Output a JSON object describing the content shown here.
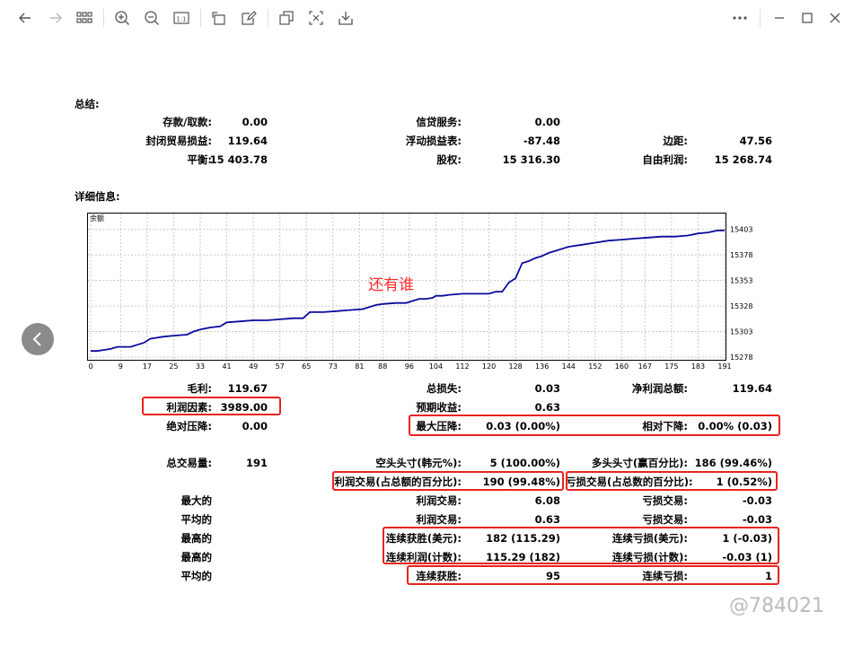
{
  "toolbar": {
    "icons": [
      "back-arrow-icon",
      "forward-arrow-icon",
      "grid-icon",
      "zoom-in-icon",
      "zoom-out-icon",
      "actual-size-icon",
      "rotate-icon",
      "edit-icon",
      "copy-icon",
      "crop-icon",
      "download-icon",
      "more-icon",
      "minimize-icon",
      "maximize-icon",
      "close-icon"
    ]
  },
  "summary": {
    "title": "总结:",
    "deposit_label": "存款/取款:",
    "deposit_value": "0.00",
    "credit_label": "信贷服务:",
    "credit_value": "0.00",
    "closed_pl_label": "封闭贸易损益:",
    "closed_pl_value": "119.64",
    "floating_label": "浮动损益表:",
    "floating_value": "-87.48",
    "margin_label": "边距:",
    "margin_value": "47.56",
    "balance_label": "平衡:",
    "balance_value": "15 403.78",
    "equity_label": "股权:",
    "equity_value": "15 316.30",
    "free_margin_label": "自由利润:",
    "free_margin_value": "15 268.74"
  },
  "details": {
    "title": "详细信息:",
    "gross_profit_label": "毛利:",
    "gross_profit_value": "119.67",
    "gross_loss_label": "总损失:",
    "gross_loss_value": "0.03",
    "net_profit_label": "净利润总额:",
    "net_profit_value": "119.64",
    "profit_factor_label": "利润因素:",
    "profit_factor_value": "3989.00",
    "expected_payoff_label": "预期收益:",
    "expected_payoff_value": "0.63",
    "abs_drawdown_label": "绝对压降:",
    "abs_drawdown_value": "0.00",
    "max_drawdown_label": "最大压降:",
    "max_drawdown_value": "0.03 (0.00%)",
    "rel_drawdown_label": "相对下降:",
    "rel_drawdown_value": "0.00% (0.03)",
    "total_trades_label": "总交易量:",
    "total_trades_value": "191",
    "short_label": "空头头寸(韩元%):",
    "short_value": "5 (100.00%)",
    "long_label": "多头头寸(赢百分比):",
    "long_value": "186 (99.46%)",
    "profit_trades_label": "利润交易(占总额的百分比):",
    "profit_trades_value": "190 (99.48%)",
    "loss_trades_label": "亏损交易(占总数的百分比):",
    "loss_trades_value": "1 (0.52%)",
    "largest_label": "最大的",
    "largest_profit_label": "利润交易:",
    "largest_profit_value": "6.08",
    "largest_loss_label": "亏损交易:",
    "largest_loss_value": "-0.03",
    "average_label": "平均的",
    "avg_profit_label": "利润交易:",
    "avg_profit_value": "0.63",
    "avg_loss_label": "亏损交易:",
    "avg_loss_value": "-0.03",
    "max_label_1": "最高的",
    "cons_wins_usd_label": "连续获胜(美元):",
    "cons_wins_usd_value": "182 (115.29)",
    "cons_loss_usd_label": "连续亏损(美元):",
    "cons_loss_usd_value": "1 (-0.03)",
    "max_label_2": "最高的",
    "cons_profit_count_label": "连续利润(计数):",
    "cons_profit_count_value": "115.29 (182)",
    "cons_loss_count_label": "连续亏损(计数):",
    "cons_loss_count_value": "-0.03 (1)",
    "average_label_2": "平均的",
    "avg_cons_wins_label": "连续获胜:",
    "avg_cons_wins_value": "95",
    "avg_cons_losses_label": "连续亏损:",
    "avg_cons_losses_value": "1"
  },
  "overlay_text": "还有谁",
  "watermark": "@784021",
  "colors": {
    "line": "#0a0a9e",
    "highlight": "#e8231f"
  },
  "chart_data": {
    "type": "line",
    "title": "余额",
    "x_ticks": [
      "0",
      "9",
      "17",
      "25",
      "33",
      "41",
      "49",
      "57",
      "65",
      "73",
      "81",
      "88",
      "96",
      "104",
      "112",
      "120",
      "128",
      "136",
      "144",
      "152",
      "160",
      "167",
      "175",
      "183",
      "191"
    ],
    "y_ticks": [
      "15403",
      "15378",
      "15353",
      "15328",
      "15303",
      "15278"
    ],
    "ylim": [
      15278,
      15408
    ],
    "xlim": [
      0,
      191
    ],
    "grid": true,
    "series": [
      {
        "values": [
          [
            0,
            15284
          ],
          [
            2,
            15284
          ],
          [
            4,
            15285
          ],
          [
            6,
            15286
          ],
          [
            8,
            15288
          ],
          [
            10,
            15288
          ],
          [
            12,
            15288
          ],
          [
            14,
            15290
          ],
          [
            16,
            15292
          ],
          [
            18,
            15296
          ],
          [
            20,
            15297
          ],
          [
            22,
            15298
          ],
          [
            25,
            15299
          ],
          [
            29,
            15300
          ],
          [
            31,
            15303
          ],
          [
            33,
            15305
          ],
          [
            36,
            15307
          ],
          [
            39,
            15308
          ],
          [
            41,
            15312
          ],
          [
            45,
            15313
          ],
          [
            49,
            15314
          ],
          [
            53,
            15314
          ],
          [
            57,
            15315
          ],
          [
            61,
            15316
          ],
          [
            64,
            15316
          ],
          [
            66,
            15322
          ],
          [
            70,
            15322
          ],
          [
            74,
            15323
          ],
          [
            78,
            15324
          ],
          [
            82,
            15325
          ],
          [
            86,
            15329
          ],
          [
            88,
            15330
          ],
          [
            92,
            15331
          ],
          [
            95,
            15331
          ],
          [
            97,
            15333
          ],
          [
            99,
            15335
          ],
          [
            101,
            15335
          ],
          [
            103,
            15336
          ],
          [
            104,
            15338
          ],
          [
            106,
            15338
          ],
          [
            108,
            15339
          ],
          [
            112,
            15340
          ],
          [
            116,
            15340
          ],
          [
            120,
            15340
          ],
          [
            122,
            15342
          ],
          [
            124,
            15342
          ],
          [
            126,
            15351
          ],
          [
            128,
            15355
          ],
          [
            130,
            15370
          ],
          [
            132,
            15372
          ],
          [
            134,
            15375
          ],
          [
            136,
            15377
          ],
          [
            138,
            15380
          ],
          [
            140,
            15382
          ],
          [
            142,
            15384
          ],
          [
            144,
            15386
          ],
          [
            148,
            15388
          ],
          [
            152,
            15390
          ],
          [
            156,
            15392
          ],
          [
            160,
            15393
          ],
          [
            164,
            15394
          ],
          [
            168,
            15395
          ],
          [
            172,
            15396
          ],
          [
            176,
            15396
          ],
          [
            180,
            15397
          ],
          [
            183,
            15399
          ],
          [
            186,
            15400
          ],
          [
            189,
            15402
          ],
          [
            191,
            15402
          ]
        ]
      }
    ]
  }
}
